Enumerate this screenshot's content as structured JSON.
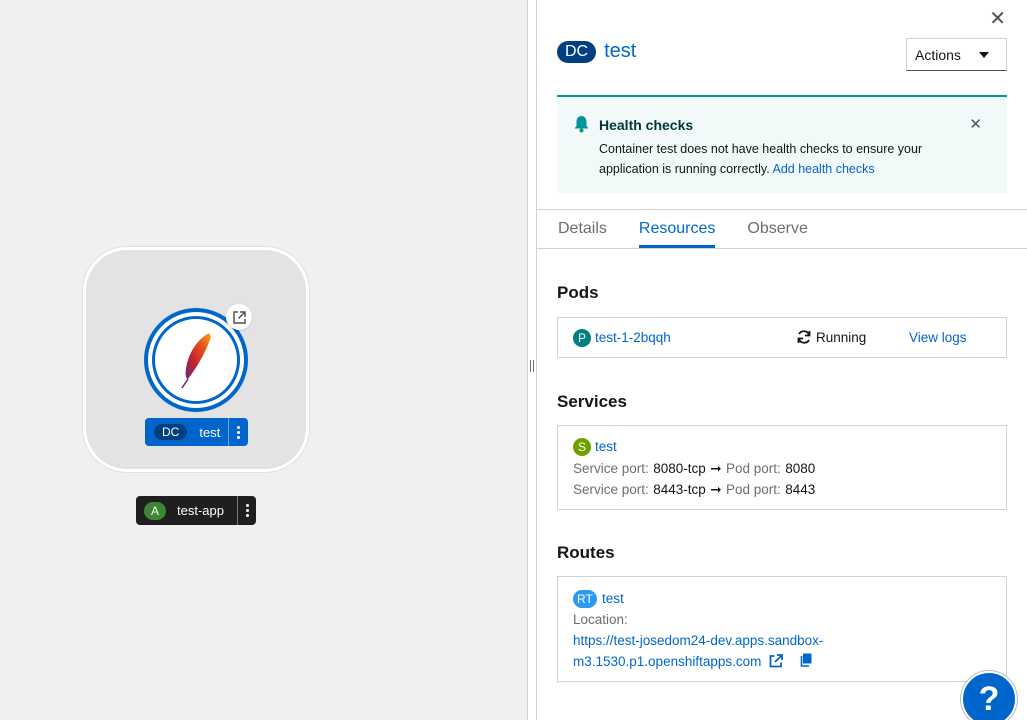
{
  "topology": {
    "node": {
      "kind_badge": "DC",
      "name": "test"
    },
    "app_group": {
      "kind_badge": "A",
      "name": "test-app"
    }
  },
  "panel": {
    "kind_badge": "DC",
    "title": "test",
    "actions_label": "Actions",
    "alert": {
      "title": "Health checks",
      "body": "Container test does not have health checks to ensure your application is running correctly.",
      "link": "Add health checks"
    },
    "tabs": [
      "Details",
      "Resources",
      "Observe"
    ],
    "active_tab": "Resources",
    "pods": {
      "heading": "Pods",
      "items": [
        {
          "badge": "P",
          "name": "test-1-2bqqh",
          "status": "Running",
          "logs_link": "View logs"
        }
      ]
    },
    "services": {
      "heading": "Services",
      "badge": "S",
      "name": "test",
      "ports": [
        {
          "service_label": "Service port:",
          "service_port": "8080-tcp",
          "pod_label": "Pod port:",
          "pod_port": "8080"
        },
        {
          "service_label": "Service port:",
          "service_port": "8443-tcp",
          "pod_label": "Pod port:",
          "pod_port": "8443"
        }
      ]
    },
    "routes": {
      "heading": "Routes",
      "badge": "RT",
      "name": "test",
      "location_label": "Location:",
      "url_line1": "https://test-josedom24-dev.apps.sandbox-",
      "url_line2": "m3.1530.p1.openshiftapps.com"
    }
  },
  "help_button": "?",
  "colors": {
    "brand_blue": "#0066cc",
    "canvas_bg": "#f0f0f0",
    "alert_teal": "#009596",
    "pod_badge": "#008080",
    "service_badge": "#6ca100",
    "route_badge": "#2b9af3",
    "app_badge": "#3e8635"
  }
}
